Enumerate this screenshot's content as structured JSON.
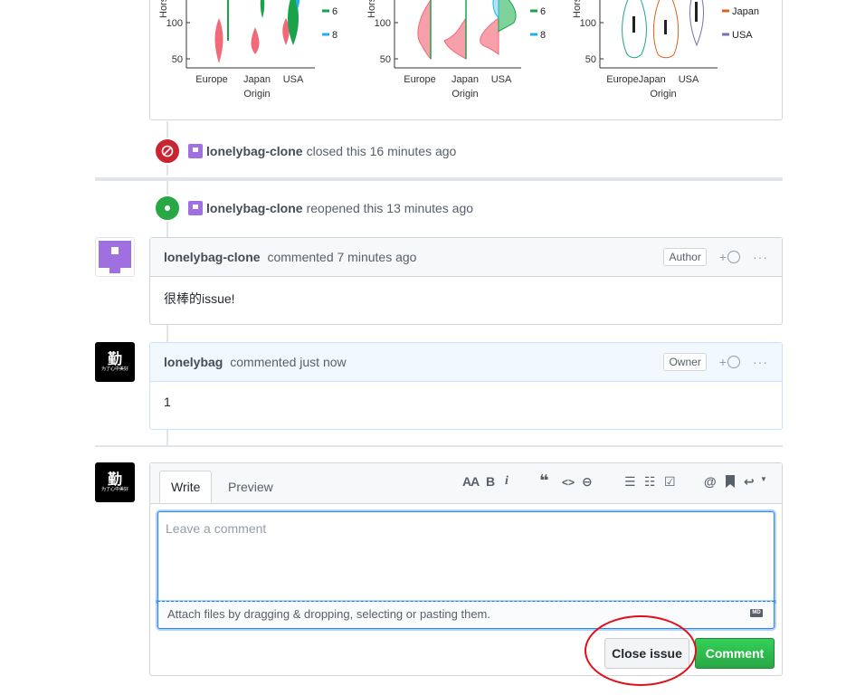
{
  "chart_data": [
    {
      "type": "violin",
      "ylabel": "Horsepower",
      "xlabel": "Origin",
      "categories": [
        "Europe",
        "Japan",
        "USA"
      ],
      "yticks": [
        50,
        100
      ],
      "legend": [
        "6",
        "8"
      ],
      "legend_colors": [
        "#1aa34a",
        "#1fb2e8"
      ],
      "colors": {
        "europe": "#f06a7a",
        "japan": "#f06a7a",
        "usa": "#1aa34a"
      }
    },
    {
      "type": "violin",
      "ylabel": "Horsepower",
      "xlabel": "Origin",
      "categories": [
        "Europe",
        "Japan",
        "USA"
      ],
      "yticks": [
        50,
        100
      ],
      "legend": [
        "6",
        "8"
      ],
      "legend_colors": [
        "#1aa34a",
        "#1fb2e8"
      ]
    },
    {
      "type": "violin",
      "ylabel": "Horsepower",
      "xlabel": "Origin",
      "categories": [
        "Europe",
        "Japan",
        "USA"
      ],
      "tick_labels": [
        "EuropeJapan",
        "USA"
      ],
      "yticks": [
        50,
        100
      ],
      "legend": [
        "Japan",
        "USA"
      ],
      "legend_colors": [
        "#d9631f",
        "#7e6bb0"
      ]
    }
  ],
  "events": {
    "closed": {
      "author": "lonelybag-clone",
      "text": "closed this 16 minutes ago"
    },
    "reopened": {
      "author": "lonelybag-clone",
      "text": "reopened this 13 minutes ago"
    }
  },
  "comments": [
    {
      "author": "lonelybag-clone",
      "meta": "commented 7 minutes ago",
      "role": "Author",
      "body": "很棒的issue!"
    },
    {
      "author": "lonelybag",
      "meta": "commented just now",
      "role": "Owner",
      "body": "1"
    }
  ],
  "avatar_text": {
    "big": "勤",
    "small": "为了心中美好"
  },
  "composer": {
    "tab_write": "Write",
    "tab_preview": "Preview",
    "placeholder": "Leave a comment",
    "attach_text": "Attach files by dragging & dropping, selecting or pasting them.",
    "md_badge": "MD",
    "close_button": "Close issue",
    "comment_button": "Comment",
    "toolbar": {
      "heading": "AA",
      "bold": "B",
      "italic": "i",
      "quote": "❝",
      "code": "<>",
      "link": "⊖",
      "ul": "☰",
      "ol": "☷",
      "tasks": "☑",
      "mention": "@",
      "bookmark": "🔖",
      "reply": "↩"
    }
  },
  "reaction_label": "+",
  "more_label": "···",
  "colors": {
    "closed": "#cb2431",
    "open": "#28a745",
    "comment_green": "#2ea44f",
    "annotation": "#e0101a"
  }
}
